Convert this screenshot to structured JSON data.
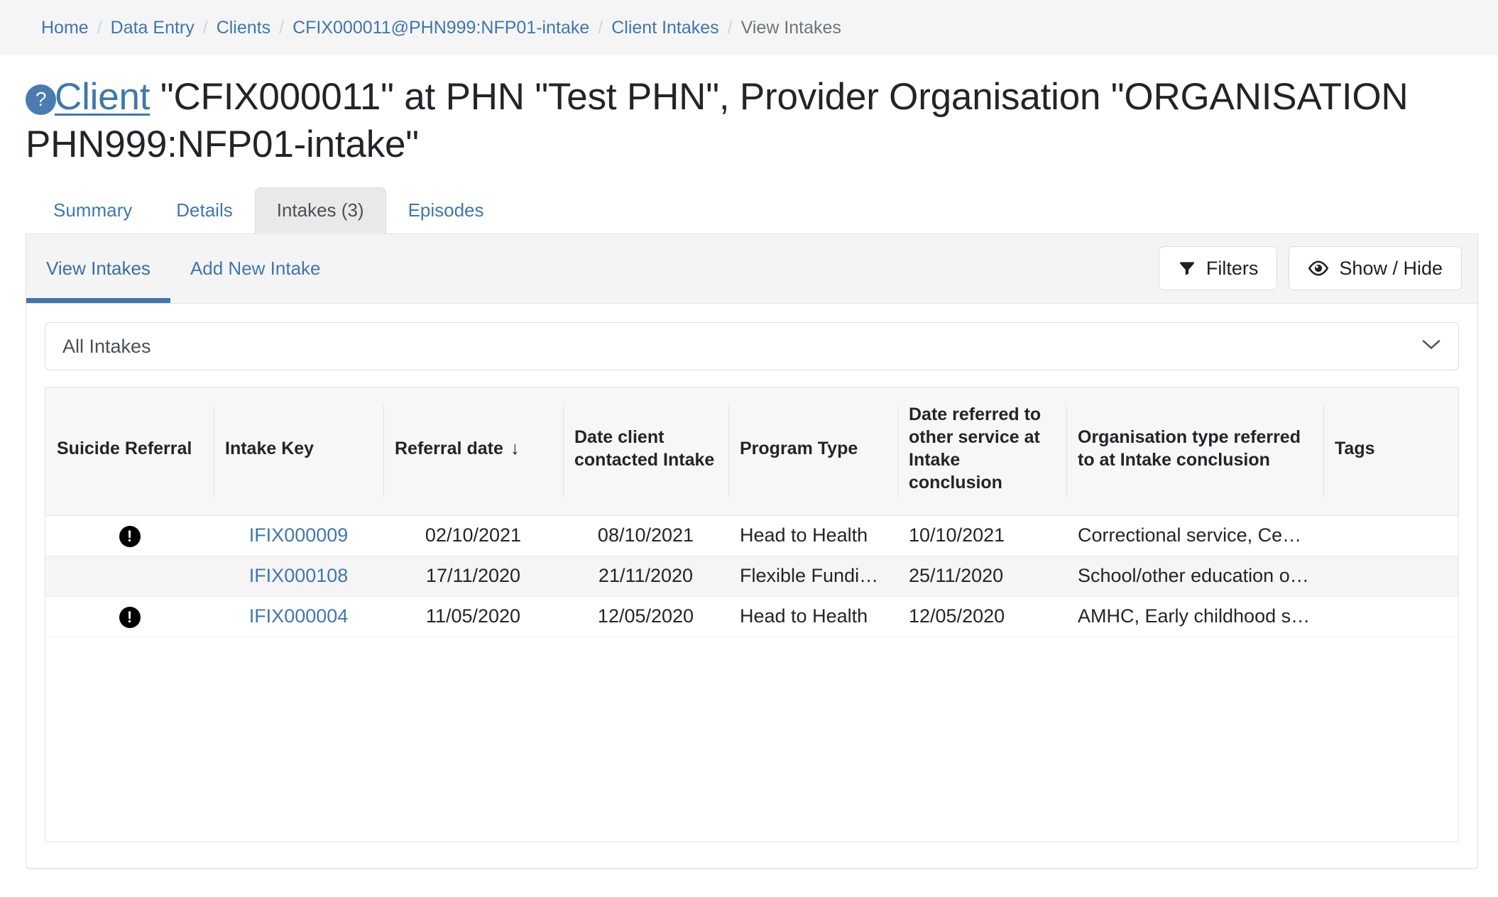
{
  "breadcrumb": {
    "separator": "/",
    "items": [
      {
        "label": "Home",
        "current": false
      },
      {
        "label": "Data Entry",
        "current": false
      },
      {
        "label": "Clients",
        "current": false
      },
      {
        "label": "CFIX000011@PHN999:NFP01-intake",
        "current": false
      },
      {
        "label": "Client Intakes",
        "current": false
      },
      {
        "label": "View Intakes",
        "current": true
      }
    ]
  },
  "title": {
    "help_icon": "question-mark-icon",
    "help_glyph": "?",
    "link_text": "Client",
    "rest": " \"CFIX000011\" at PHN \"Test PHN\", Provider Organisation \"ORGANISATION PHN999:NFP01-intake\""
  },
  "nav_tabs": [
    {
      "label": "Summary",
      "active": false
    },
    {
      "label": "Details",
      "active": false
    },
    {
      "label": "Intakes (3)",
      "active": true
    },
    {
      "label": "Episodes",
      "active": false
    }
  ],
  "sub_tabs": [
    {
      "label": "View Intakes",
      "active": true
    },
    {
      "label": "Add New Intake",
      "active": false
    }
  ],
  "toolbar": {
    "filters_label": "Filters",
    "filters_icon": "funnel-icon",
    "show_hide_label": "Show / Hide",
    "show_hide_icon": "eye-icon"
  },
  "intake_filter": {
    "selected": "All Intakes",
    "options": [
      "All Intakes"
    ]
  },
  "table": {
    "columns": [
      {
        "label": "Suicide Referral",
        "sort": ""
      },
      {
        "label": "Intake Key",
        "sort": ""
      },
      {
        "label": "Referral date",
        "sort": "↓"
      },
      {
        "label": "Date client contacted Intake",
        "sort": ""
      },
      {
        "label": "Program Type",
        "sort": ""
      },
      {
        "label": "Date referred to other service at Intake conclusion",
        "sort": ""
      },
      {
        "label": "Organisation type referred to at Intake conclusion",
        "sort": ""
      },
      {
        "label": "Tags",
        "sort": ""
      }
    ],
    "rows": [
      {
        "suicide_referral": true,
        "intake_key": "IFIX000009",
        "referral_date": "02/10/2021",
        "date_client_contacted": "08/10/2021",
        "program_type": "Head to Health",
        "date_referred_other": "10/10/2021",
        "org_type_referred": "Correctional service, Centre…",
        "tags": ""
      },
      {
        "suicide_referral": false,
        "intake_key": "IFIX000108",
        "referral_date": "17/11/2020",
        "date_client_contacted": "21/11/2020",
        "program_type": "Flexible Funding…",
        "date_referred_other": "25/11/2020",
        "org_type_referred": "School/other education or t…",
        "tags": ""
      },
      {
        "suicide_referral": true,
        "intake_key": "IFIX000004",
        "referral_date": "11/05/2020",
        "date_client_contacted": "12/05/2020",
        "program_type": "Head to Health",
        "date_referred_other": "12/05/2020",
        "org_type_referred": "AMHC, Early childhood servi…",
        "tags": ""
      }
    ],
    "alert_glyph": "!"
  },
  "colors": {
    "link": "#3f77ad",
    "muted": "#6c757d",
    "help_badge": "#4a7cb0",
    "active_tab_bg": "#e9e9e9",
    "header_bg": "#f4f4f5",
    "table_head_bg": "#f7f7f8",
    "alt_row_bg": "#f5f5f5"
  }
}
